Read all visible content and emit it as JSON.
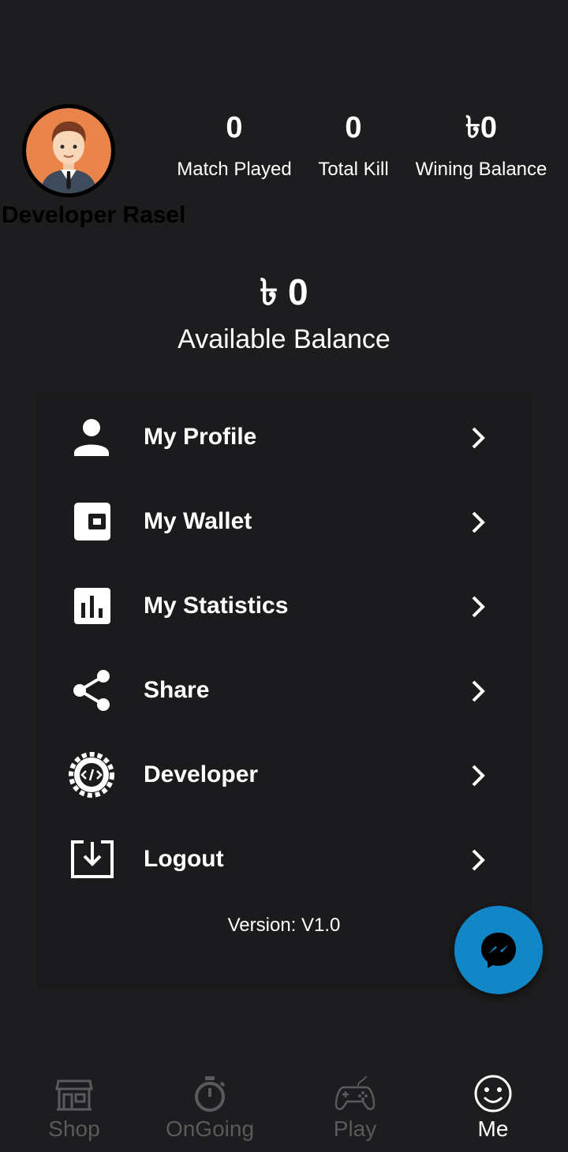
{
  "profile": {
    "name": "Developer Rasel",
    "avatar_icon": "user-avatar-icon"
  },
  "stats": [
    {
      "value": "0",
      "label": "Match Played"
    },
    {
      "value": "0",
      "label": "Total Kill"
    },
    {
      "value": "৳0",
      "label": "Wining Balance"
    }
  ],
  "balance": {
    "amount": "৳ 0",
    "label": "Available Balance"
  },
  "menu": {
    "items": [
      {
        "label": "My Profile",
        "icon": "person-icon"
      },
      {
        "label": "My Wallet",
        "icon": "wallet-icon"
      },
      {
        "label": "My Statistics",
        "icon": "bar-chart-icon"
      },
      {
        "label": "Share",
        "icon": "share-icon"
      },
      {
        "label": "Developer",
        "icon": "developer-gear-icon"
      },
      {
        "label": "Logout",
        "icon": "logout-icon"
      }
    ],
    "version": "Version: V1.0"
  },
  "fab": {
    "icon": "messenger-icon",
    "color": "#1287c8"
  },
  "bottom_nav": {
    "items": [
      {
        "label": "Shop",
        "icon": "shop-icon",
        "active": false
      },
      {
        "label": "OnGoing",
        "icon": "stopwatch-icon",
        "active": false
      },
      {
        "label": "Play",
        "icon": "gamepad-icon",
        "active": false
      },
      {
        "label": "Me",
        "icon": "smiley-icon",
        "active": true
      }
    ]
  },
  "colors": {
    "background": "#1d1d1f",
    "text": "#ffffff",
    "inactive_nav": "#5a5a5c"
  }
}
